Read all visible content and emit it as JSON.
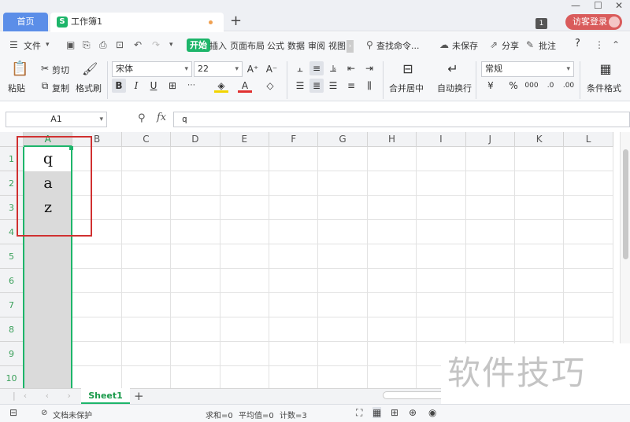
{
  "titlebar": {
    "home_tab": "首页",
    "doc_tab": "工作簿1",
    "doc_icon": "S",
    "add_tab": "+",
    "badge": "1",
    "login": "访客登录"
  },
  "menubar": {
    "file": "文件",
    "start": "开始",
    "items": [
      "插入",
      "页面布局",
      "公式",
      "数据",
      "审阅",
      "视图"
    ],
    "search": "查找命令...",
    "unsaved": "未保存",
    "share": "分享",
    "comment": "批注",
    "help": "?"
  },
  "ribbon": {
    "paste": "粘贴",
    "cut": "剪切",
    "copy": "复制",
    "format_painter": "格式刷",
    "font_name": "宋体",
    "font_size": "22",
    "bold": "B",
    "italic": "I",
    "underline": "U",
    "merge_center": "合并居中",
    "wrap": "自动换行",
    "number_format": "常规",
    "percent": "%",
    "cond_format": "条件格式"
  },
  "formula_bar": {
    "name_box": "A1",
    "fx": "fx",
    "content": "q"
  },
  "grid": {
    "columns": [
      "A",
      "B",
      "C",
      "D",
      "E",
      "F",
      "G",
      "H",
      "I",
      "J",
      "K",
      "L"
    ],
    "rows": [
      "1",
      "2",
      "3",
      "4",
      "5",
      "6",
      "7",
      "8",
      "9",
      "10"
    ],
    "cells": [
      "q",
      "a",
      "z"
    ]
  },
  "sheets": {
    "active": "Sheet1",
    "add": "+"
  },
  "statusbar": {
    "protect": "文档未保护",
    "sum": "求和=0",
    "avg": "平均值=0",
    "count": "计数=3"
  },
  "watermark": "软件技巧",
  "colors": {
    "accent_green": "#1db56a",
    "home_tab_blue": "#5b8ee8",
    "login_red": "#d95b5b",
    "highlight_red": "#d03030"
  }
}
